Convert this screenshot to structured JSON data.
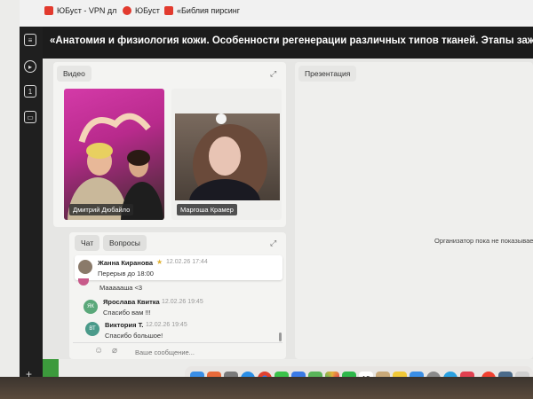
{
  "browser": {
    "tabs": [
      {
        "label": "ЮБуст - VPN дл",
        "color": "#e23a2e"
      },
      {
        "label": "ЮБуст",
        "color": "#e23a2e"
      },
      {
        "label": "«Библия пирсинг",
        "color": "#e23a2e"
      }
    ]
  },
  "sidebar": {
    "items": [
      {
        "label": "",
        "icon": "menu-icon"
      },
      {
        "label": "",
        "icon": "record-icon"
      },
      {
        "label": "1",
        "icon": "number-one-icon"
      },
      {
        "label": "",
        "icon": "screen-share-icon"
      }
    ]
  },
  "header": {
    "title": "«Анатомия и физиология кожи. Особенности регенерации различных типов тканей. Этапы заживле"
  },
  "video": {
    "label": "Видео",
    "participants": [
      {
        "name": "Дмитрий Дюбайло"
      },
      {
        "name": "Маргоша Крамер"
      }
    ]
  },
  "presentation": {
    "label": "Презентация",
    "placeholder": "Организатор пока не показывает"
  },
  "chat": {
    "tabs": {
      "chat": "Чат",
      "questions": "Вопросы"
    },
    "pinned": {
      "author": "Жанна Киранова",
      "star": "★",
      "time": "12.02.26 17:44",
      "text": "Перерыв до 18:00"
    },
    "messages": [
      {
        "initials": "",
        "author": "",
        "time": "",
        "text": "Маааааша <3",
        "color": "#c85a8a"
      },
      {
        "initials": "ЯК",
        "author": "Ярослава Квитка",
        "time": "12.02.26 19:45",
        "text": "Спасибо вам !!!",
        "color": "#5aa87a"
      },
      {
        "initials": "ВТ",
        "author": "Виктория Т.",
        "time": "12.02.26 19:45",
        "text": "Спасибо большое!",
        "color": "#4a9a8a"
      }
    ],
    "input_placeholder": "Ваше сообщение..."
  },
  "dock": {
    "calendar_day": "12",
    "apps": [
      {
        "icon": "finder-icon",
        "color": "#3a8ee6"
      },
      {
        "icon": "launchpad-icon",
        "color": "#e86a3a"
      },
      {
        "icon": "apps-grid-icon",
        "color": "#7a7a7a"
      },
      {
        "icon": "safari-icon",
        "color": "#2a8ee6"
      },
      {
        "icon": "chrome-icon",
        "color": "#e04030"
      },
      {
        "icon": "messages-icon",
        "color": "#3ac24a"
      },
      {
        "icon": "mail-icon",
        "color": "#3a7ae6"
      },
      {
        "icon": "maps-icon",
        "color": "#5ab45a"
      },
      {
        "icon": "photos-icon",
        "color": "#e8b23a"
      },
      {
        "icon": "facetime-icon",
        "color": "#2eb84a"
      },
      {
        "icon": "calendar-icon",
        "color": "#ffffff"
      },
      {
        "icon": "contacts-icon",
        "color": "#c8a878"
      },
      {
        "icon": "notes-icon",
        "color": "#f0c838"
      },
      {
        "icon": "appstore-icon",
        "color": "#3a8ee6"
      },
      {
        "icon": "settings-icon",
        "color": "#8a8a8a"
      },
      {
        "icon": "telegram-icon",
        "color": "#2aa0e0"
      },
      {
        "icon": "music-icon",
        "color": "#e04050"
      },
      {
        "icon": "yandex-icon",
        "color": "#f04030"
      },
      {
        "icon": "screens-icon",
        "color": "#4a6a8a"
      },
      {
        "icon": "trash-icon",
        "color": "#cfcfcf"
      }
    ]
  }
}
